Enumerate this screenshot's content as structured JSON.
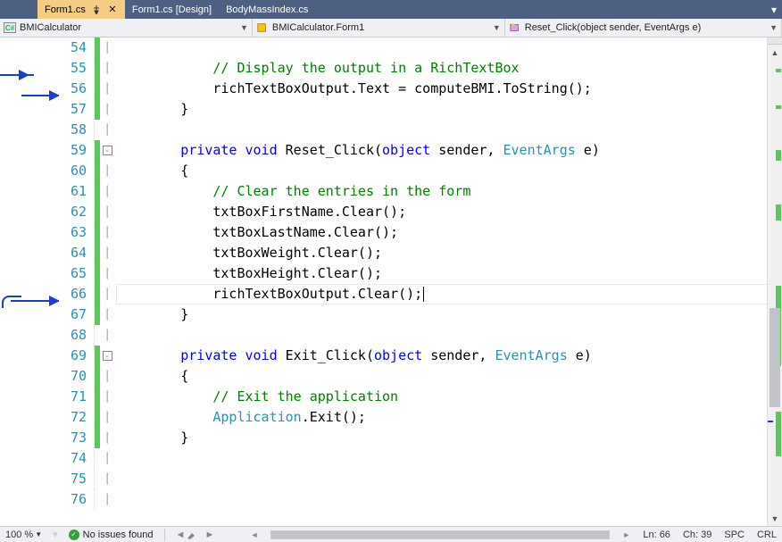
{
  "tabs": [
    {
      "label": "Form1.cs",
      "active": true,
      "pinned": true,
      "closable": true
    },
    {
      "label": "Form1.cs [Design]",
      "active": false
    },
    {
      "label": "BodyMassIndex.cs",
      "active": false
    }
  ],
  "nav": {
    "project": "BMICalculator",
    "class": "BMICalculator.Form1",
    "member": "Reset_Click(object sender, EventArgs e)"
  },
  "lines": {
    "54": {
      "num": "54",
      "change": true,
      "code": ""
    },
    "55": {
      "num": "55",
      "change": true,
      "fold": "",
      "comment": "// Display the output in a RichTextBox"
    },
    "56": {
      "num": "56",
      "change": true,
      "text1": "richTextBoxOutput.Text = computeBMI.ToString();"
    },
    "57": {
      "num": "57",
      "change": true,
      "text1": "}"
    },
    "58": {
      "num": "58",
      "text1": ""
    },
    "59": {
      "num": "59",
      "change": true,
      "fold": "-",
      "kw1": "private",
      "kw2": "void",
      "name": "Reset_Click(",
      "kw3": "object",
      "rest1": " sender, ",
      "type1": "EventArgs",
      "rest2": " e)"
    },
    "60": {
      "num": "60",
      "change": true,
      "text1": "{"
    },
    "61": {
      "num": "61",
      "change": true,
      "comment": "// Clear the entries in the form"
    },
    "62": {
      "num": "62",
      "change": true,
      "text1": "txtBoxFirstName.Clear();"
    },
    "63": {
      "num": "63",
      "change": true,
      "text1": "txtBoxLastName.Clear();"
    },
    "64": {
      "num": "64",
      "change": true,
      "text1": "txtBoxWeight.Clear();"
    },
    "65": {
      "num": "65",
      "change": true,
      "text1": "txtBoxHeight.Clear();"
    },
    "66": {
      "num": "66",
      "change": true,
      "caret": true,
      "text1": "richTextBoxOutput.Clear();"
    },
    "67": {
      "num": "67",
      "change": true,
      "text1": "}"
    },
    "68": {
      "num": "68",
      "text1": ""
    },
    "69": {
      "num": "69",
      "change": true,
      "fold": "-",
      "kw1": "private",
      "kw2": "void",
      "name": "Exit_Click(",
      "kw3": "object",
      "rest1": " sender, ",
      "type1": "EventArgs",
      "rest2": " e)"
    },
    "70": {
      "num": "70",
      "change": true,
      "text1": "{"
    },
    "71": {
      "num": "71",
      "change": true,
      "comment": "// Exit the application"
    },
    "72": {
      "num": "72",
      "change": true,
      "type1": "Application",
      "rest1": ".Exit();"
    },
    "73": {
      "num": "73",
      "change": true,
      "text1": "}"
    },
    "74": {
      "num": "74",
      "text1": ""
    },
    "75": {
      "num": "75",
      "text1": ""
    },
    "76": {
      "num": "76",
      "text1": ""
    }
  },
  "status": {
    "zoom": "100 %",
    "issues": "No issues found",
    "ln": "Ln: 66",
    "ch": "Ch: 39",
    "spc": "SPC",
    "crlf": "CRL"
  }
}
